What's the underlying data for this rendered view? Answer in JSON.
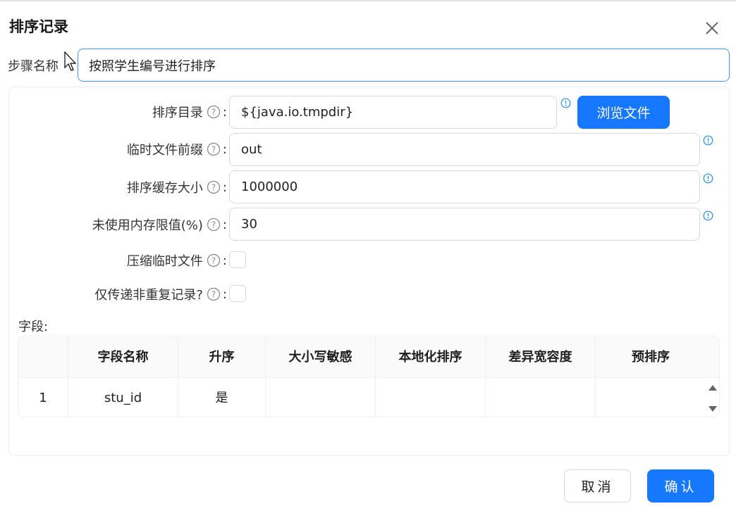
{
  "dialog": {
    "title": "排序记录",
    "close_icon": "close-icon"
  },
  "step": {
    "label": "步骤名称",
    "value": "按照学生编号进行排序"
  },
  "form": {
    "sort_dir": {
      "label": "排序目录",
      "value": "${java.io.tmpdir}",
      "browse_label": "浏览文件"
    },
    "prefix": {
      "label": "临时文件前缀",
      "value": "out"
    },
    "cache_size": {
      "label": "排序缓存大小",
      "value": "1000000"
    },
    "free_memory": {
      "label": "未使用内存限值(%)",
      "value": "30"
    },
    "compress": {
      "label": "压缩临时文件",
      "checked": false
    },
    "unique": {
      "label": "仅传递非重复记录?",
      "checked": false
    },
    "colon": ":"
  },
  "fields": {
    "label": "字段:",
    "columns": [
      "",
      "字段名称",
      "升序",
      "大小写敏感",
      "本地化排序",
      "差异宽容度",
      "预排序"
    ],
    "rows": [
      [
        "1",
        "stu_id",
        "是",
        "",
        "",
        "",
        ""
      ]
    ]
  },
  "footer": {
    "cancel_label": "取消",
    "ok_label": "确认"
  },
  "colors": {
    "primary": "#1677ff",
    "border": "#d9d9d9",
    "info": "#1890ff"
  }
}
